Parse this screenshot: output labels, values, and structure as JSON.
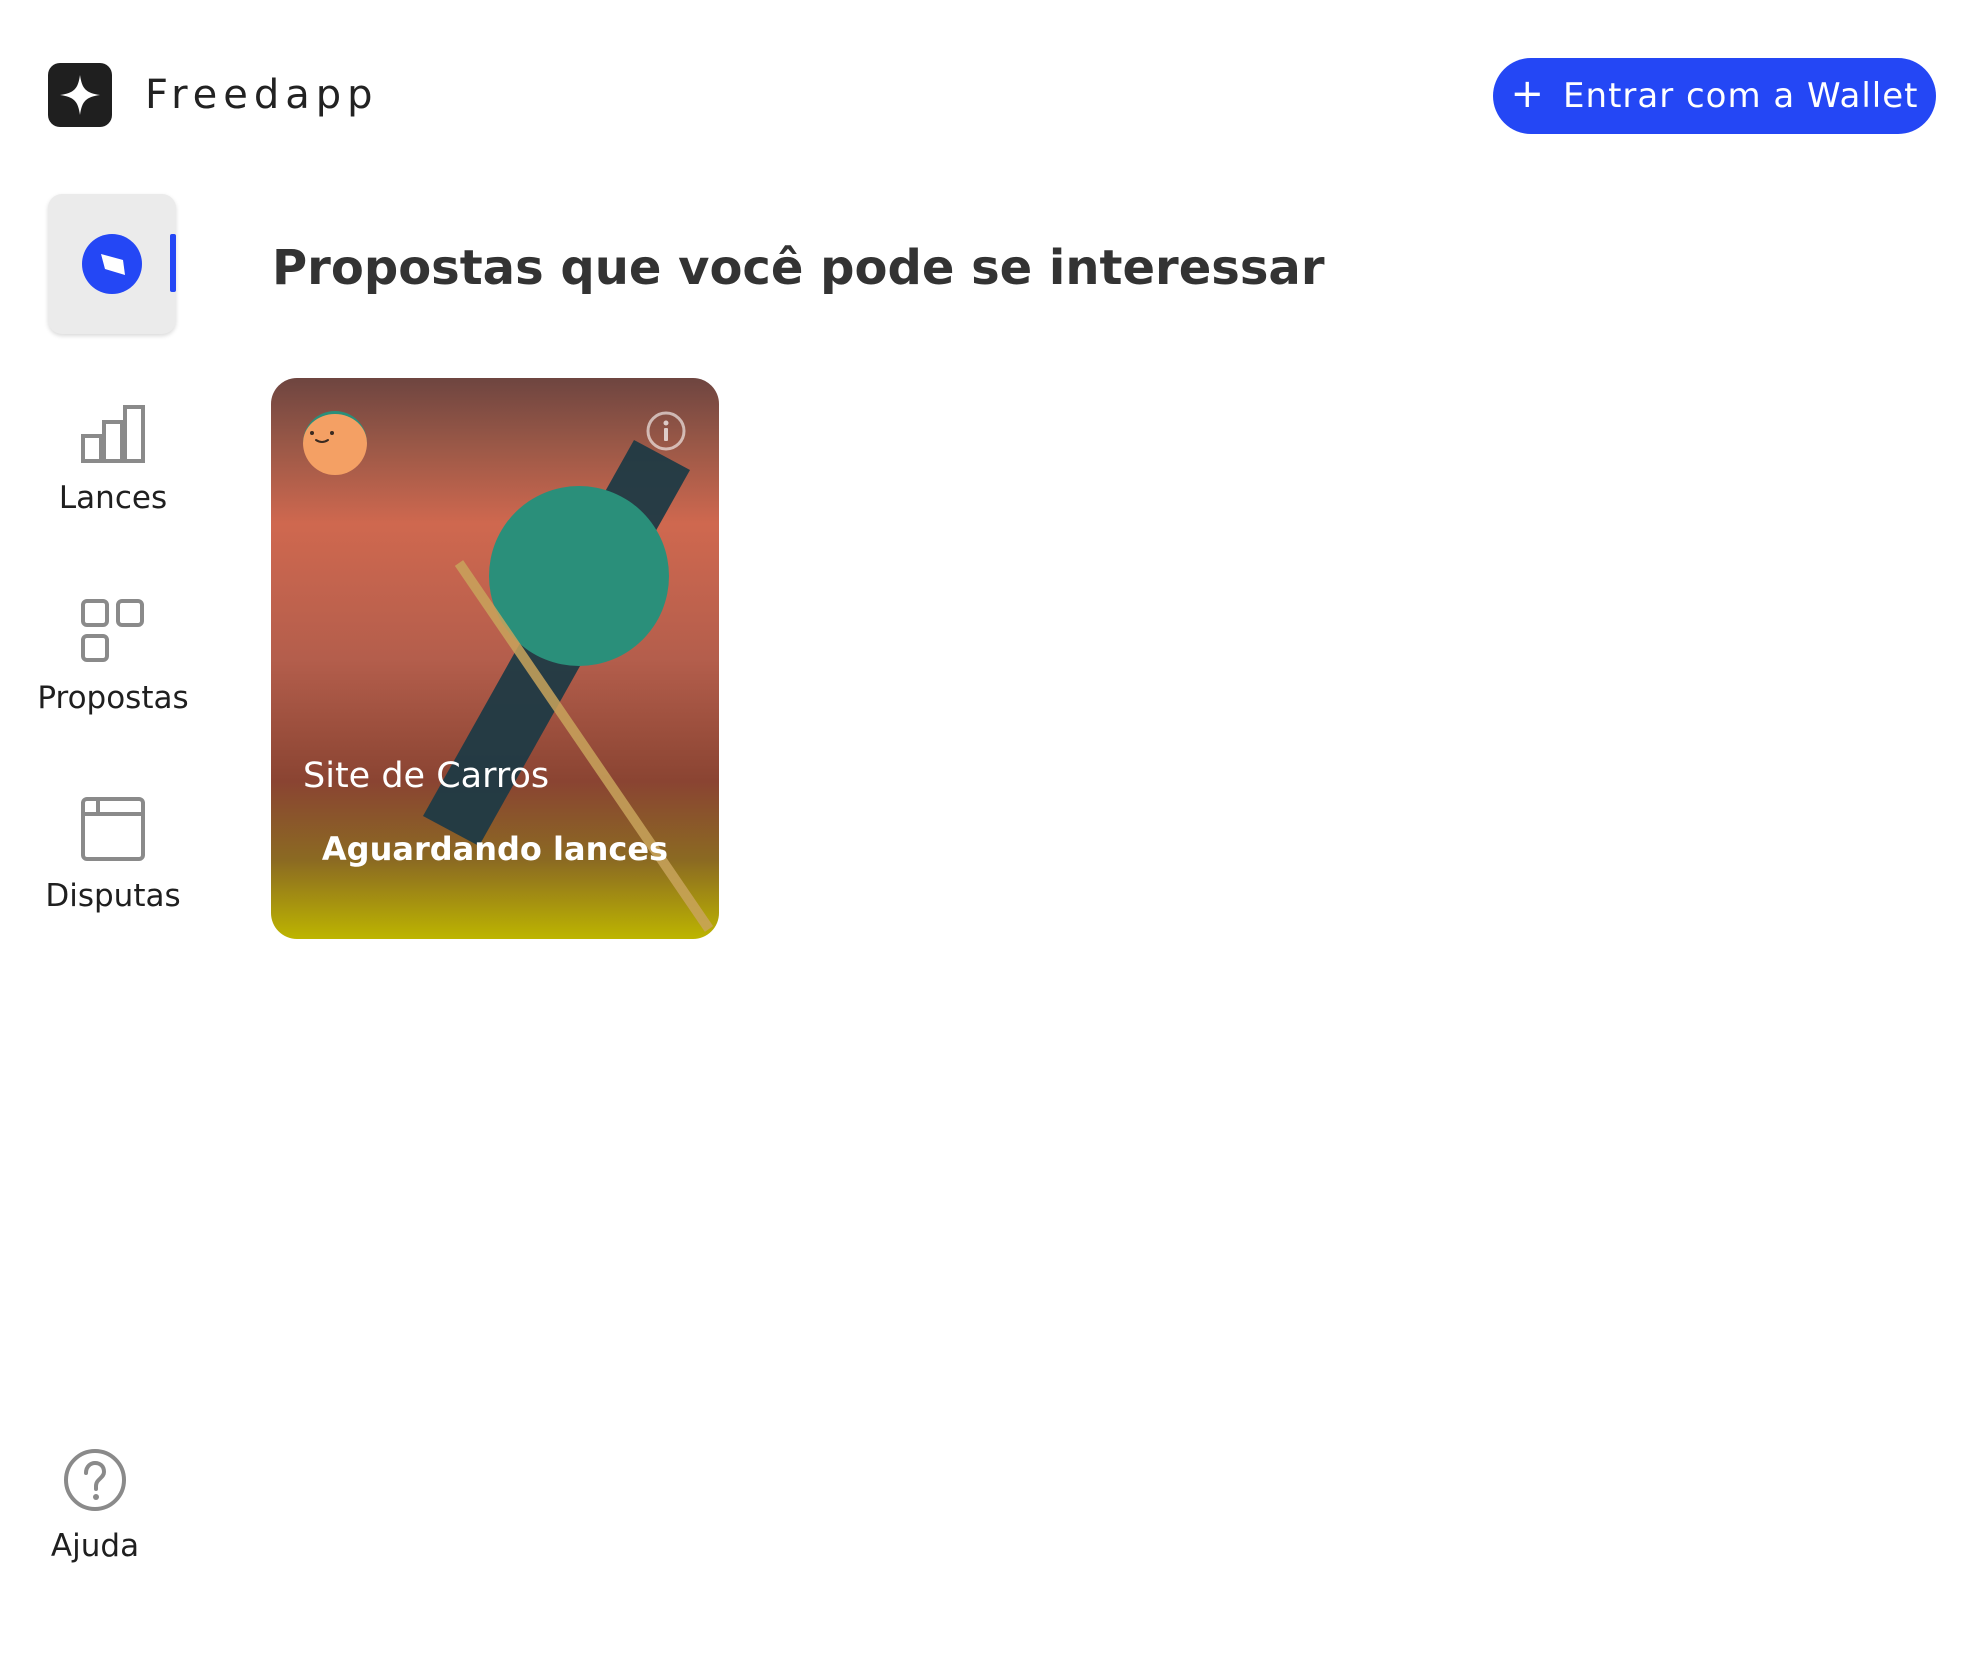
{
  "header": {
    "brand": "Freedapp",
    "logo_icon": "sparkle-icon",
    "wallet_button": {
      "icon": "plus-icon",
      "label": "Entrar com a Wallet"
    }
  },
  "sidebar": {
    "items": [
      {
        "id": "explore",
        "label": "",
        "icon": "compass-icon",
        "active": true
      },
      {
        "id": "lances",
        "label": "Lances",
        "icon": "bar-chart-icon",
        "active": false
      },
      {
        "id": "propostas",
        "label": "Propostas",
        "icon": "grid-icon",
        "active": false
      },
      {
        "id": "disputas",
        "label": "Disputas",
        "icon": "window-icon",
        "active": false
      }
    ],
    "help": {
      "label": "Ajuda",
      "icon": "question-circle-icon"
    }
  },
  "main": {
    "title": "Propostas que você pode se interessar",
    "cards": [
      {
        "title": "Site de Carros",
        "status": "Aguardando lances",
        "avatar_icon": "smiley-avatar-icon",
        "info_icon": "info-icon"
      }
    ]
  },
  "colors": {
    "accent": "#2447f5",
    "active_tab_bg": "#ebebeb",
    "text": "#333333",
    "card_teal": "#2a8f7a",
    "card_avatar": "#f4a064"
  }
}
